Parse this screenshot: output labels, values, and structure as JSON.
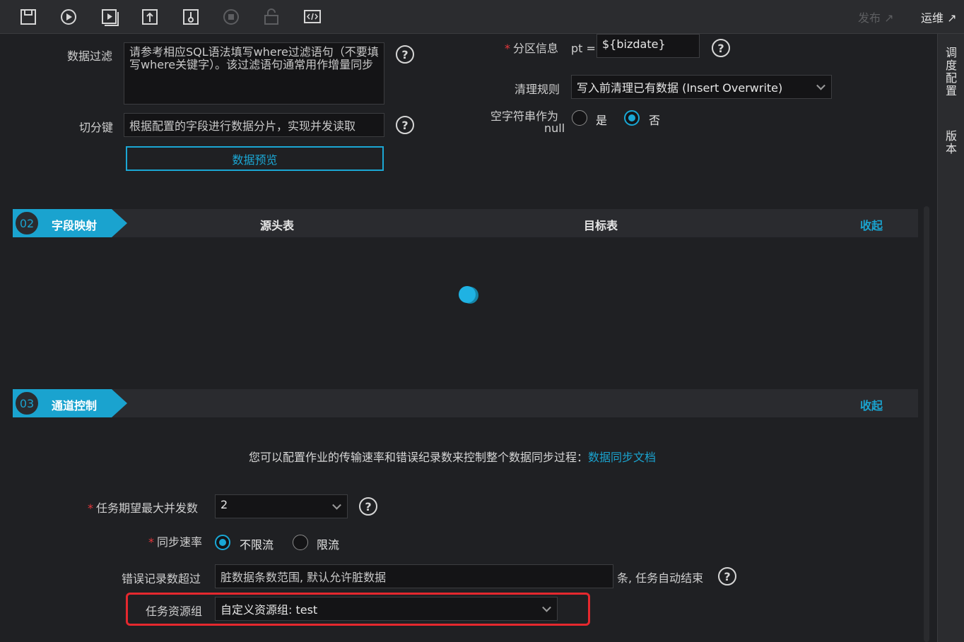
{
  "toolbar": {
    "icons": [
      "save-icon",
      "run-icon",
      "run-params-icon",
      "submit-icon",
      "deploy-icon",
      "stop-icon",
      "lock-icon",
      "code-icon"
    ],
    "publish_label": "发布 ↗",
    "ops_label": "运维 ↗"
  },
  "rightbar": {
    "schedule_label": "调度配置",
    "version_label": "版本"
  },
  "source": {
    "filter_label": "数据过滤",
    "filter_placeholder": "请参考相应SQL语法填写where过滤语句（不要填写where关键字）。该过滤语句通常用作增量同步",
    "split_label": "切分键",
    "split_placeholder": "根据配置的字段进行数据分片，实现并发读取",
    "preview_button": "数据预览"
  },
  "target": {
    "partition_label": "分区信息",
    "partition_prefix": "pt =",
    "partition_value": "${bizdate}",
    "clean_label": "清理规则",
    "clean_value": "写入前清理已有数据 (Insert Overwrite)",
    "null_label_line1": "空字符串作为",
    "null_label_line2": "null",
    "null_yes": "是",
    "null_no": "否"
  },
  "mapping_section": {
    "number": "02",
    "title": "字段映射",
    "source_col": "源头表",
    "target_col": "目标表",
    "collapse": "收起"
  },
  "channel_section": {
    "number": "03",
    "title": "通道控制",
    "collapse": "收起",
    "info_text": "您可以配置作业的传输速率和错误纪录数来控制整个数据同步过程：",
    "info_link": "数据同步文档",
    "concurrency_label": "任务期望最大并发数",
    "concurrency_value": "2",
    "rate_label": "同步速率",
    "rate_unlimited": "不限流",
    "rate_limited": "限流",
    "error_label": "错误记录数超过",
    "error_placeholder": "脏数据条数范围, 默认允许脏数据",
    "error_suffix": "条, 任务自动结束",
    "resource_label": "任务资源组",
    "resource_value": "自定义资源组: test"
  },
  "colors": {
    "accent": "#1aa3cf",
    "required": "#e5373b",
    "highlight": "#e5282e"
  }
}
